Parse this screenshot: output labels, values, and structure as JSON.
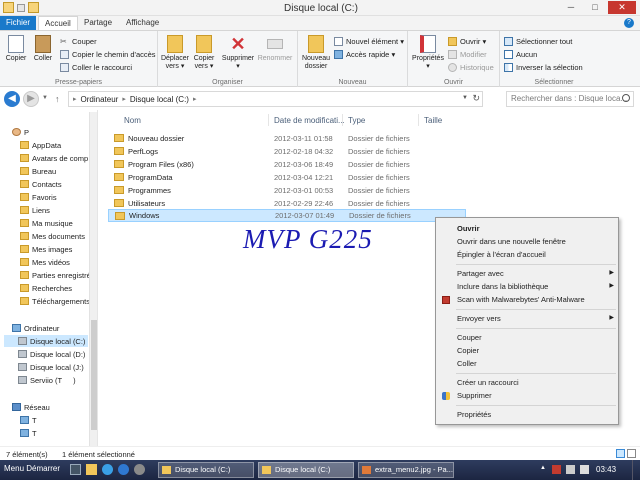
{
  "window": {
    "title": "Disque local (C:)",
    "controls": {
      "minimize": "─",
      "maximize": "□",
      "close": "✕"
    }
  },
  "ribbon_tabs": {
    "file": "Fichier",
    "home": "Accueil",
    "share": "Partage",
    "view": "Affichage",
    "help": "?"
  },
  "ribbon": {
    "clipboard": {
      "label": "Presse-papiers",
      "copy": "Copier",
      "paste": "Coller",
      "cut": "Couper",
      "copy_path": "Copier le chemin d'accès",
      "paste_shortcut": "Coller le raccourci"
    },
    "organize": {
      "label": "Organiser",
      "move_to": [
        "Déplacer",
        "vers ▾"
      ],
      "copy_to": [
        "Copier",
        "vers ▾"
      ],
      "delete": [
        "Supprimer",
        "▾"
      ],
      "rename": "Renommer"
    },
    "new": {
      "label": "Nouveau",
      "new_folder": [
        "Nouveau",
        "dossier"
      ],
      "new_item": "Nouvel élément ▾",
      "easy_access": "Accès rapide ▾"
    },
    "open": {
      "label": "Ouvrir",
      "properties": [
        "Propriétés",
        "▾"
      ],
      "open": "Ouvrir ▾",
      "edit": "Modifier",
      "history": "Historique"
    },
    "select": {
      "label": "Sélectionner",
      "select_all": "Sélectionner tout",
      "select_none": "Aucun",
      "invert": "Inverser la sélection"
    }
  },
  "address": {
    "back": "◀",
    "forward": "▶",
    "recent": "▼",
    "up": "↑",
    "path": [
      "Ordinateur",
      "Disque local (C:)"
    ],
    "separator": "▸",
    "dropdown": "▼",
    "refresh": "↻",
    "search_placeholder": "Rechercher dans : Disque loca..."
  },
  "nav_pane": {
    "items": [
      {
        "label": "P",
        "icon": "user-icon"
      },
      {
        "label": "AppData",
        "icon": "folder-icon"
      },
      {
        "label": "Avatars de comp",
        "icon": "folder-icon"
      },
      {
        "label": "Bureau",
        "icon": "folder-icon"
      },
      {
        "label": "Contacts",
        "icon": "folder-icon"
      },
      {
        "label": "Favoris",
        "icon": "folder-icon"
      },
      {
        "label": "Liens",
        "icon": "folder-icon"
      },
      {
        "label": "Ma musique",
        "icon": "folder-icon"
      },
      {
        "label": "Mes documents",
        "icon": "folder-icon"
      },
      {
        "label": "Mes images",
        "icon": "folder-icon"
      },
      {
        "label": "Mes vidéos",
        "icon": "folder-icon"
      },
      {
        "label": "Parties enregistré",
        "icon": "folder-icon"
      },
      {
        "label": "Recherches",
        "icon": "folder-icon"
      },
      {
        "label": "Téléchargements",
        "icon": "folder-icon"
      },
      {
        "label": "Ordinateur",
        "icon": "computer-icon"
      },
      {
        "label": "Disque local (C:)",
        "icon": "drive-icon",
        "selected": true
      },
      {
        "label": "Disque local (D:)",
        "icon": "drive-icon"
      },
      {
        "label": "Disque local (J:)",
        "icon": "drive-icon"
      },
      {
        "label": "Serviio (T",
        "extra": ")",
        "icon": "drive-icon"
      },
      {
        "label": "Réseau",
        "icon": "network-icon"
      },
      {
        "label": "T",
        "icon": "network-computer-icon"
      },
      {
        "label": "T",
        "icon": "network-computer-icon"
      }
    ]
  },
  "file_list": {
    "columns": [
      "Nom",
      "Date de modificati...",
      "Type",
      "Taille"
    ],
    "rows": [
      {
        "name": "Nouveau dossier",
        "date": "2012-03-11 01:58",
        "type": "Dossier de fichiers"
      },
      {
        "name": "PerfLogs",
        "date": "2012-02-18 04:32",
        "type": "Dossier de fichiers"
      },
      {
        "name": "Program Files (x86)",
        "date": "2012-03-06 18:49",
        "type": "Dossier de fichiers"
      },
      {
        "name": "ProgramData",
        "date": "2012-03-04 12:21",
        "type": "Dossier de fichiers"
      },
      {
        "name": "Programmes",
        "date": "2012-03-01 00:53",
        "type": "Dossier de fichiers"
      },
      {
        "name": "Utilisateurs",
        "date": "2012-02-29 22:46",
        "type": "Dossier de fichiers"
      },
      {
        "name": "Windows",
        "date": "2012-03-07 01:49",
        "type": "Dossier de fichiers",
        "selected": true
      }
    ]
  },
  "watermark": "MVP G225",
  "context_menu": {
    "items": [
      {
        "label": "Ouvrir",
        "bold": true
      },
      {
        "label": "Ouvrir dans une nouvelle fenêtre"
      },
      {
        "label": "Épingler à l'écran d'accueil"
      },
      {
        "label": "Partager avec",
        "submenu": true
      },
      {
        "label": "Inclure dans la bibliothèque",
        "submenu": true
      },
      {
        "label": "Scan with Malwarebytes' Anti-Malware",
        "icon": "malwarebytes-icon"
      },
      {
        "label": "Envoyer vers",
        "submenu": true
      },
      {
        "label": "Couper"
      },
      {
        "label": "Copier"
      },
      {
        "label": "Coller"
      },
      {
        "label": "Créer un raccourci"
      },
      {
        "label": "Supprimer",
        "icon": "shield-icon"
      },
      {
        "label": "Propriétés"
      }
    ],
    "submenu_arrow": "▶"
  },
  "status": {
    "count": "7 élément(s)",
    "selected": "1 élément sélectionné"
  },
  "taskbar": {
    "start": "Menu Démarrer",
    "tasks": [
      "Disque local (C:)",
      "Disque local (C:)",
      "extra_menu2.jpg - Pa..."
    ],
    "clock": "03:43",
    "tray": "▲"
  },
  "colors": {
    "accent": "#1979ca",
    "selection": "#cce8ff",
    "watermark": "#1b1bb2",
    "taskbar": "#1c2541"
  }
}
